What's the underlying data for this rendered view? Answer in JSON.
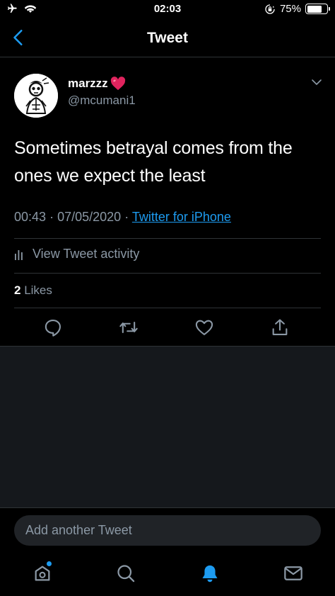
{
  "status_bar": {
    "time": "02:03",
    "battery_text": "75%",
    "battery_level": 0.75,
    "icons": [
      "airplane-icon",
      "wifi-icon",
      "orientation-lock-icon",
      "battery-icon"
    ]
  },
  "nav": {
    "title": "Tweet",
    "back_icon": "chevron-left-icon"
  },
  "tweet": {
    "display_name": "marzzz",
    "name_emoji_icon": "red-heart-icon",
    "handle": "@mcumani1",
    "text": "Sometimes betrayal comes from the ones we expect the least",
    "time": "00:43",
    "separator": "·",
    "date": "07/05/2020",
    "source": "Twitter for iPhone",
    "activity_label": "View Tweet activity",
    "likes_count": "2",
    "likes_label": "Likes",
    "actions": [
      "reply-icon",
      "retweet-icon",
      "like-icon",
      "share-icon"
    ]
  },
  "compose": {
    "placeholder": "Add another Tweet"
  },
  "tab_bar": {
    "tabs": [
      "home-icon",
      "search-icon",
      "notifications-icon",
      "messages-icon"
    ],
    "active": "notifications-icon"
  },
  "colors": {
    "accent": "#1d9bf0",
    "background": "#000000",
    "secondary_text": "#8b98a5",
    "divider": "#2f3336"
  }
}
